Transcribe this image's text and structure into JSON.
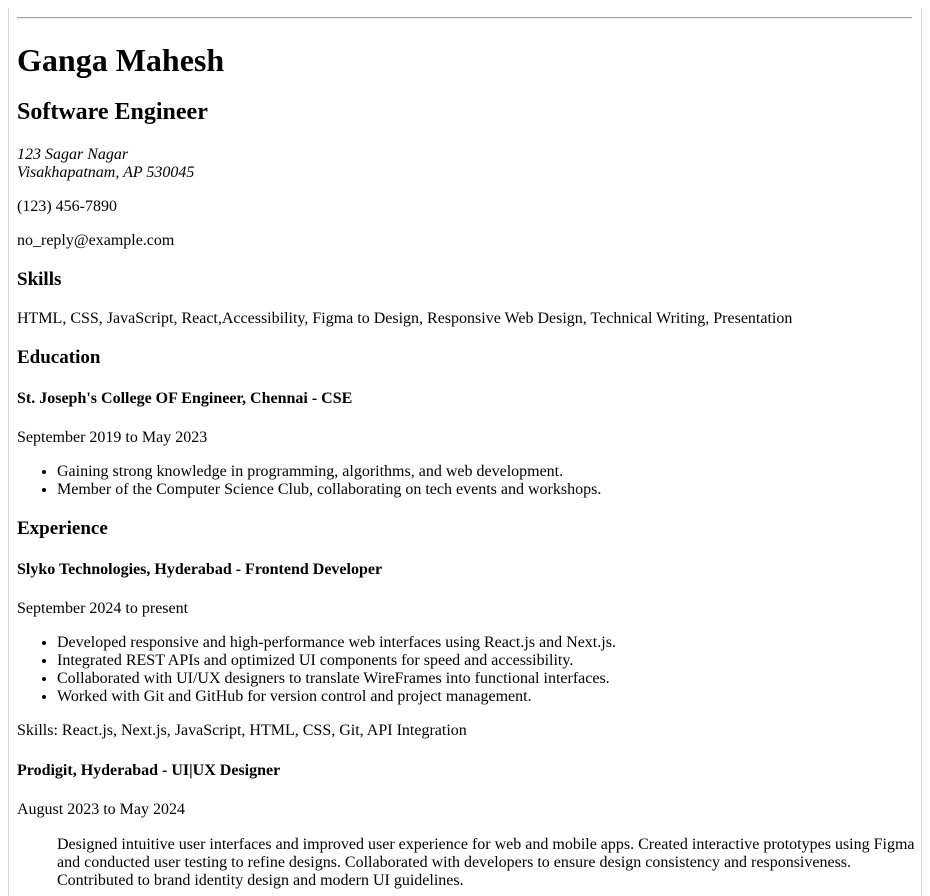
{
  "header": {
    "name": "Ganga Mahesh",
    "title": "Software Engineer",
    "address_line1": "123 Sagar Nagar",
    "address_line2": "Visakhapatnam, AP 530045",
    "phone": "(123) 456-7890",
    "email": "no_reply@example.com"
  },
  "skills": {
    "heading": "Skills",
    "text": "HTML, CSS, JavaScript, React,Accessibility, Figma to Design, Responsive Web Design, Technical Writing, Presentation"
  },
  "education": {
    "heading": "Education",
    "school": "St. Joseph's College OF Engineer, Chennai - CSE",
    "dates": "September 2019 to May 2023",
    "bullets": [
      "Gaining strong knowledge in programming, algorithms, and web development.",
      "Member of the Computer Science Club, collaborating on tech events and workshops."
    ]
  },
  "experience": {
    "heading": "Experience",
    "jobs": [
      {
        "title": "Slyko Technologies, Hyderabad - Frontend Developer",
        "dates": "September 2024 to present",
        "bullets": [
          "Developed responsive and high-performance web interfaces using React.js and Next.js.",
          "Integrated REST APIs and optimized UI components for speed and accessibility.",
          "Collaborated with UI/UX designers to translate WireFrames into functional interfaces.",
          "Worked with Git and GitHub for version control and project management."
        ],
        "skills": "Skills: React.js, Next.js, JavaScript, HTML, CSS, Git, API Integration"
      },
      {
        "title": "Prodigit, Hyderabad - UI|UX Designer",
        "dates": "August 2023 to May 2024",
        "description": "Designed intuitive user interfaces and improved user experience for web and mobile apps. Created interactive prototypes using Figma and conducted user testing to refine designs. Collaborated with developers to ensure design consistency and responsiveness. Contributed to brand identity design and modern UI guidelines."
      }
    ]
  }
}
